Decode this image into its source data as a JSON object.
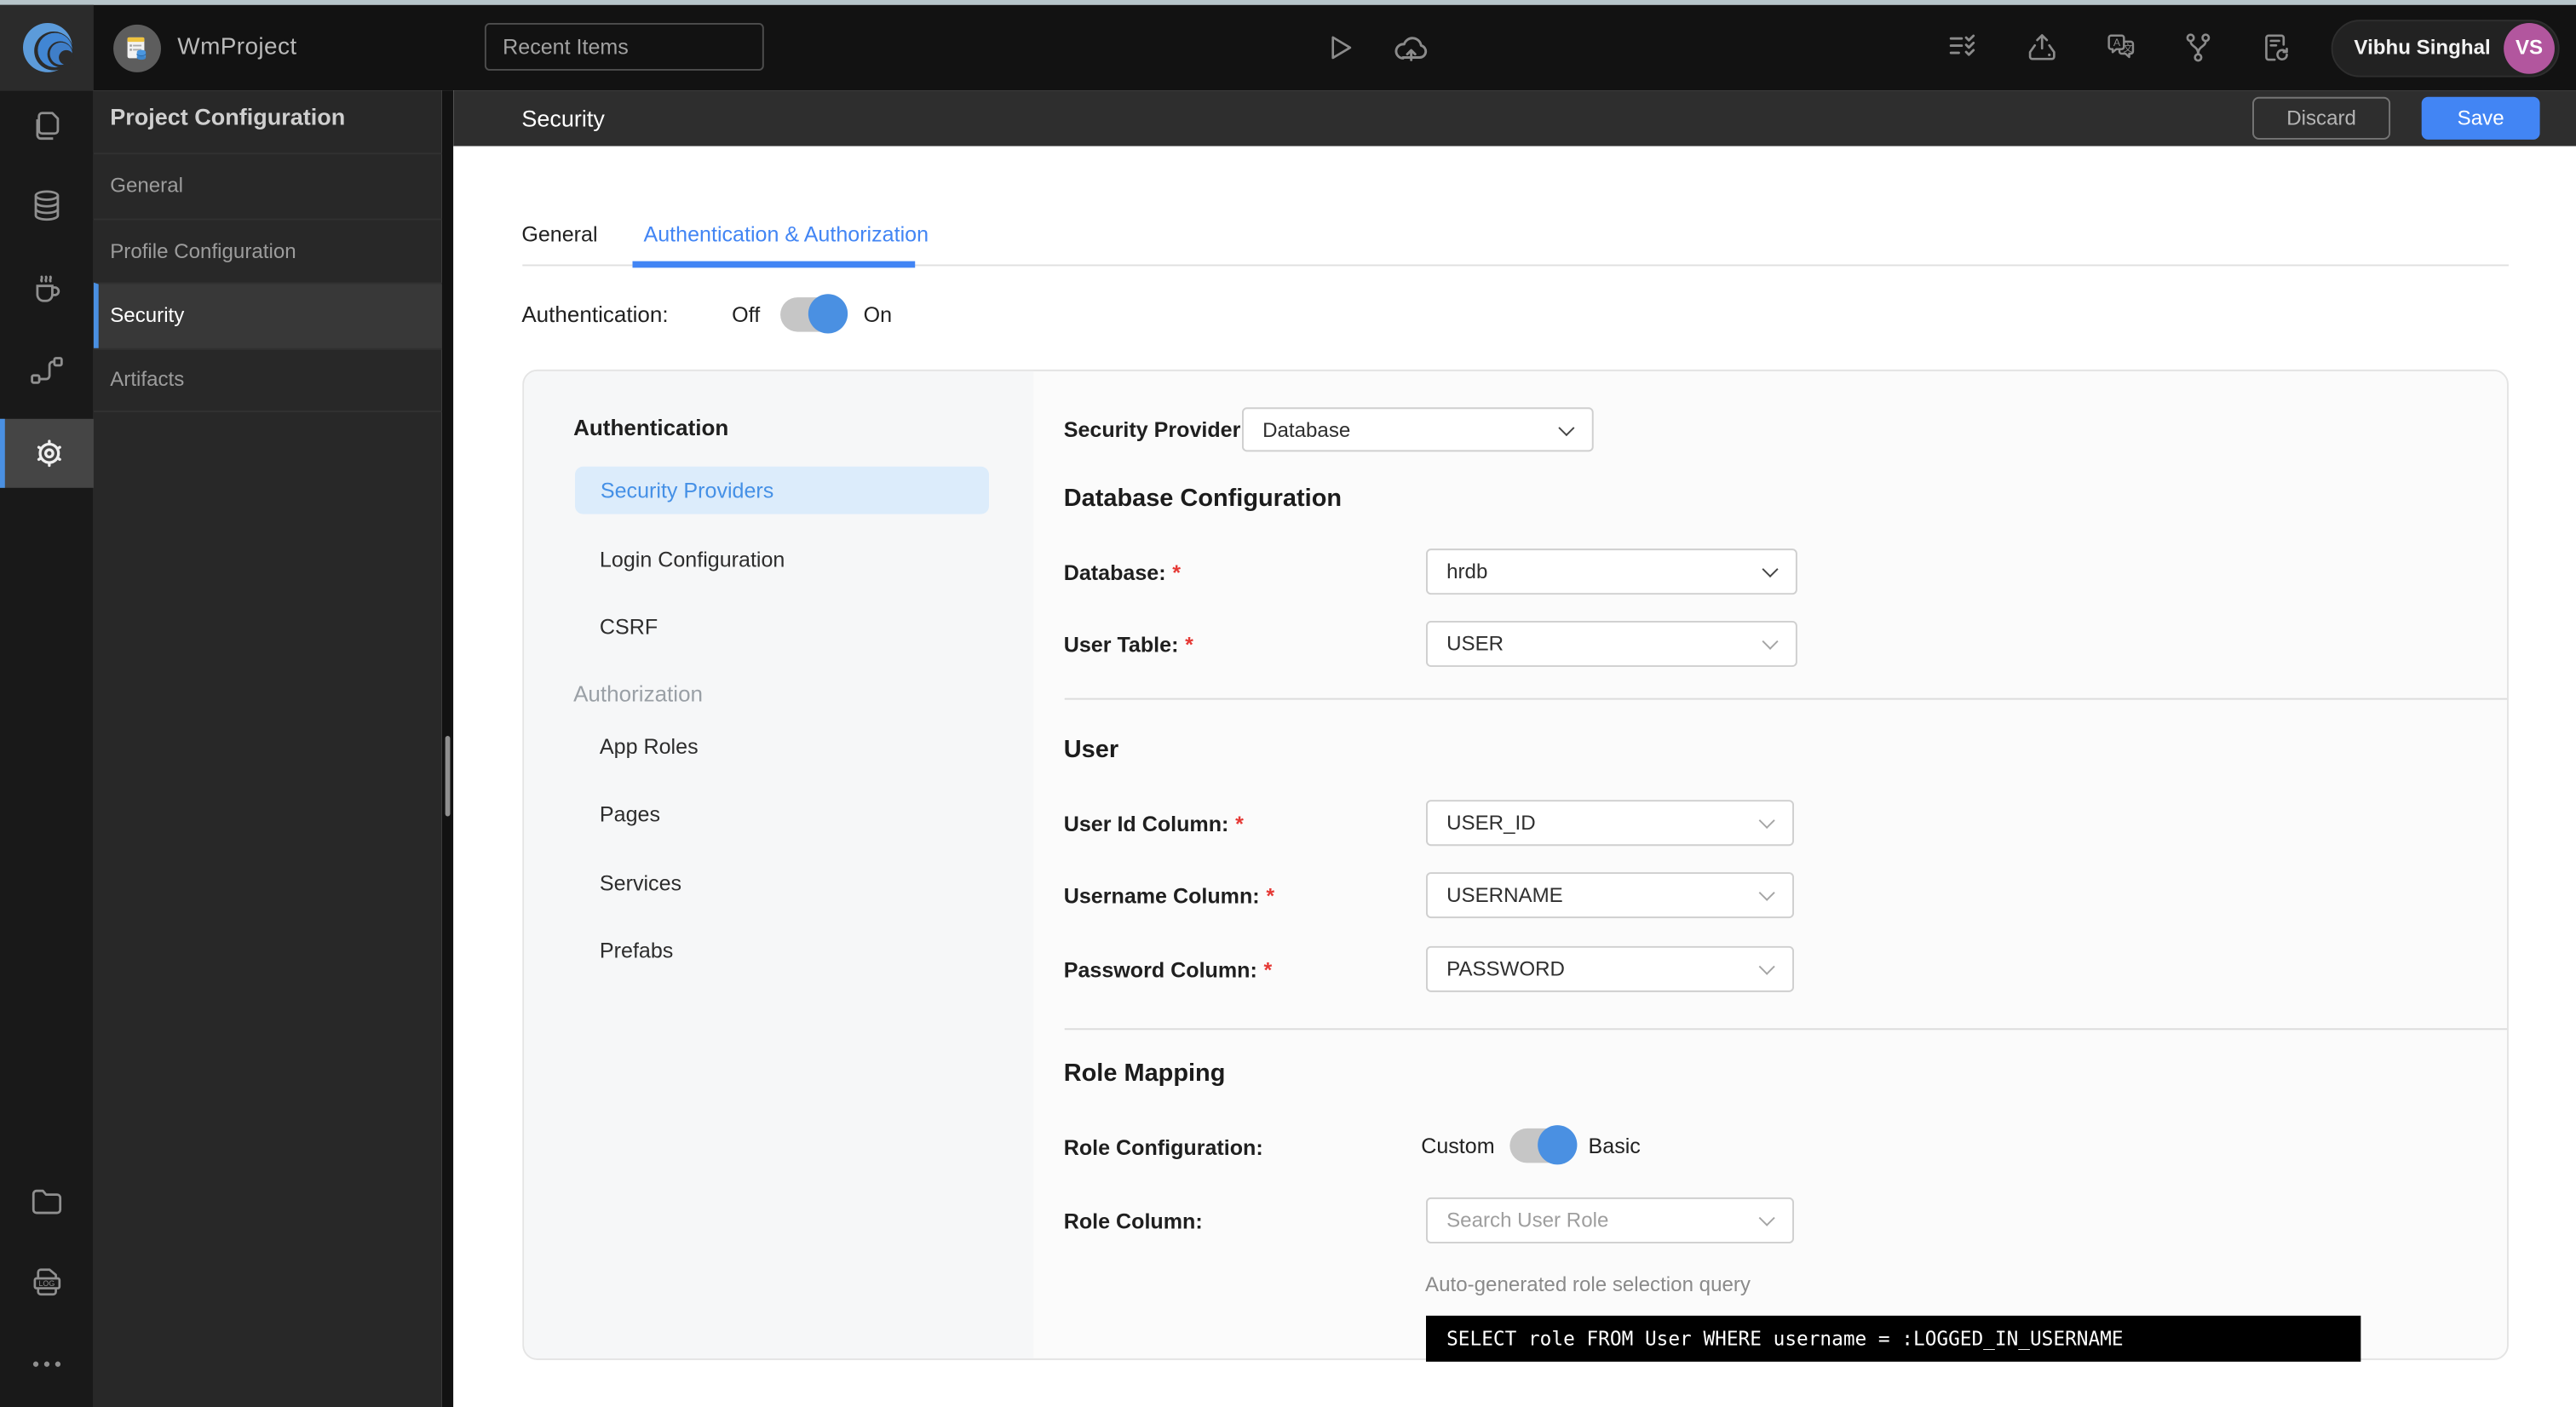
{
  "topbar": {
    "project_name": "WmProject",
    "search_placeholder": "Recent Items",
    "user_name": "Vibhu Singhal",
    "user_initials": "VS"
  },
  "left_panel": {
    "title": "Project Configuration",
    "items": [
      {
        "label": "General",
        "selected": false
      },
      {
        "label": "Profile Configuration",
        "selected": false
      },
      {
        "label": "Security",
        "selected": true
      },
      {
        "label": "Artifacts",
        "selected": false
      }
    ]
  },
  "main": {
    "header_title": "Security",
    "discard_label": "Discard",
    "save_label": "Save",
    "tabs": [
      {
        "label": "General",
        "active": false
      },
      {
        "label": "Authentication & Authorization",
        "active": true
      }
    ],
    "auth_toggle": {
      "label": "Authentication:",
      "off_label": "Off",
      "on_label": "On",
      "value": "on"
    },
    "subnav": {
      "sections": [
        {
          "title": "Authentication",
          "items": [
            {
              "label": "Security Providers",
              "selected": true
            },
            {
              "label": "Login Configuration",
              "selected": false
            },
            {
              "label": "CSRF",
              "selected": false
            }
          ]
        },
        {
          "title": "Authorization",
          "items": [
            {
              "label": "App Roles",
              "selected": false
            },
            {
              "label": "Pages",
              "selected": false
            },
            {
              "label": "Services",
              "selected": false
            },
            {
              "label": "Prefabs",
              "selected": false
            }
          ]
        }
      ]
    },
    "form": {
      "required_marker": "*",
      "security_provider": {
        "label": "Security Provider",
        "value": "Database"
      },
      "db_section_title": "Database Configuration",
      "database": {
        "label": "Database:",
        "required": true,
        "value": "hrdb"
      },
      "user_table": {
        "label": "User Table:",
        "required": true,
        "value": "USER"
      },
      "user_section_title": "User",
      "user_id_column": {
        "label": "User Id Column:",
        "required": true,
        "value": "USER_ID"
      },
      "username_column": {
        "label": "Username Column:",
        "required": true,
        "value": "USERNAME"
      },
      "password_column": {
        "label": "Password Column:",
        "required": true,
        "value": "PASSWORD"
      },
      "role_section_title": "Role Mapping",
      "role_configuration": {
        "label": "Role Configuration:",
        "left_label": "Custom",
        "right_label": "Basic",
        "value": "basic"
      },
      "role_column": {
        "label": "Role Column:",
        "placeholder": "Search User Role"
      },
      "query_caption": "Auto-generated role selection query",
      "query": "SELECT role FROM User WHERE username = :LOGGED_IN_USERNAME"
    }
  },
  "icons": {
    "log_badge": "LOG",
    "translate_a": "A",
    "translate_char": "文"
  },
  "colors": {
    "accent_blue": "#4285f4",
    "toggle_blue": "#4a90e2",
    "avatar_purple": "#b2569e",
    "required_red": "#e53935",
    "subnav_selected_bg": "#dcecfb",
    "topbar_bg": "#121212",
    "panel_bg": "#282828",
    "header_bg": "#2e2e2e"
  }
}
